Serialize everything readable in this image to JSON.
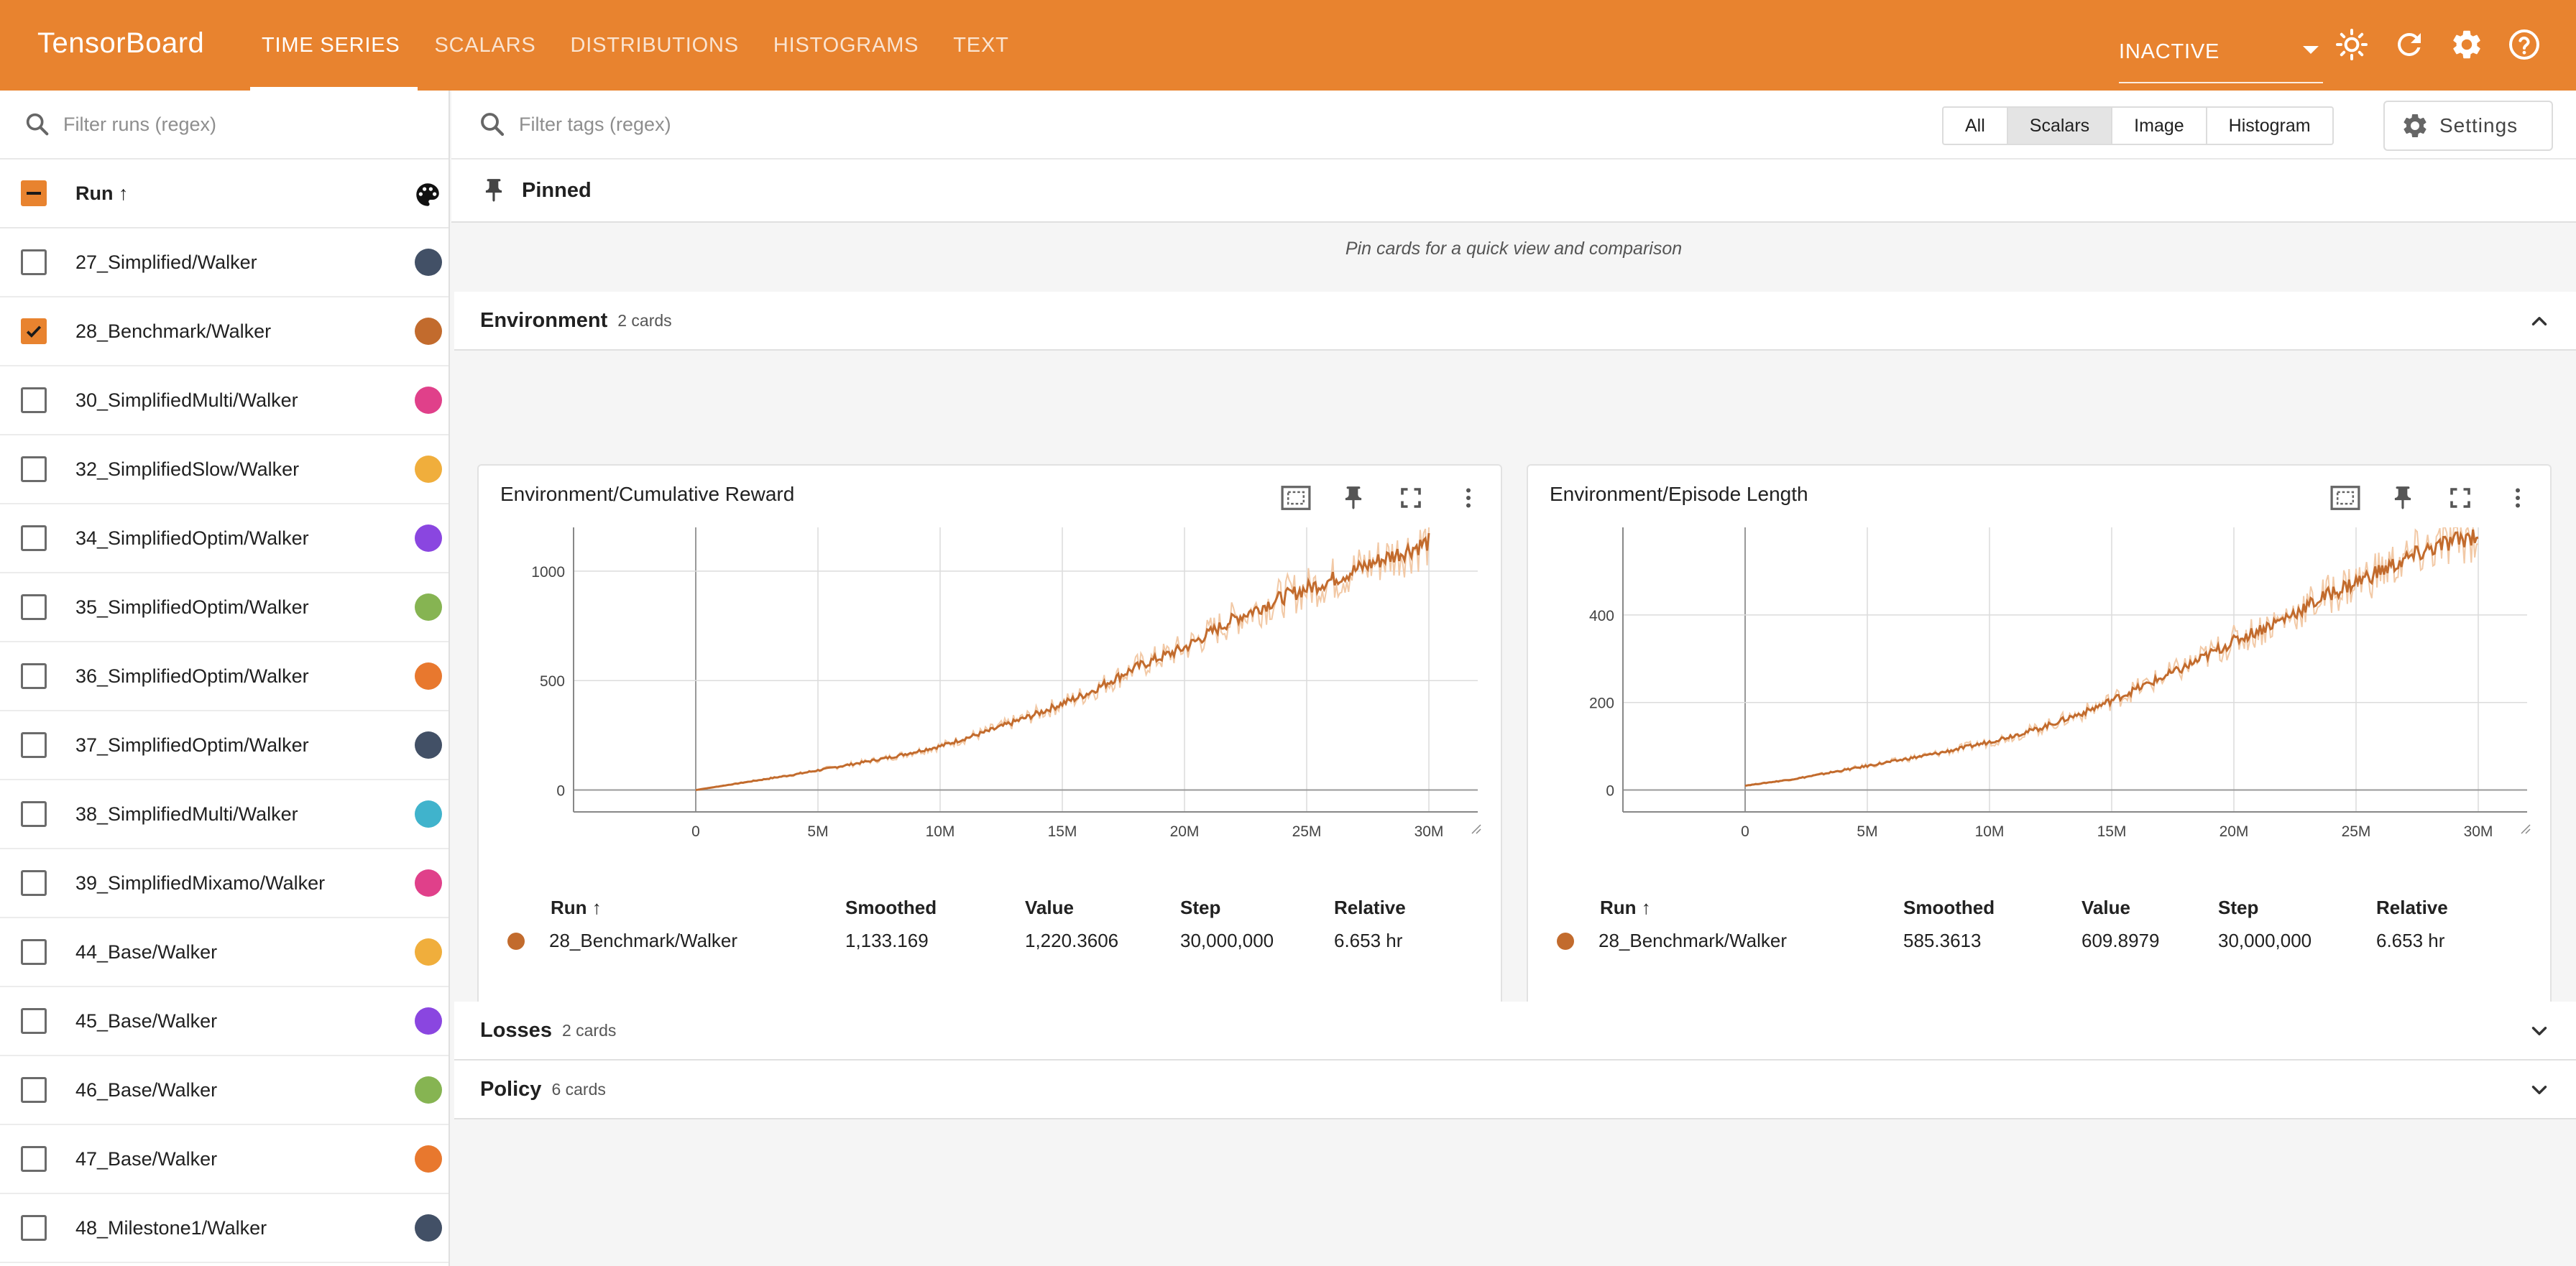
{
  "header": {
    "brand": "TensorBoard",
    "tabs": [
      {
        "label": "TIME SERIES",
        "active": true
      },
      {
        "label": "SCALARS"
      },
      {
        "label": "DISTRIBUTIONS"
      },
      {
        "label": "HISTOGRAMS"
      },
      {
        "label": "TEXT"
      }
    ],
    "reload_state": "INACTIVE",
    "icons": [
      "chevron-down-icon",
      "brightness-icon",
      "refresh-icon",
      "gear-icon",
      "help-icon"
    ]
  },
  "sidebar": {
    "filter_placeholder": "Filter runs (regex)",
    "header": {
      "label": "Run ↑"
    },
    "runs": [
      {
        "name": "27_Simplified/Walker",
        "checked": false,
        "color": "#425066"
      },
      {
        "name": "28_Benchmark/Walker",
        "checked": true,
        "color": "#c26b2d"
      },
      {
        "name": "30_SimplifiedMulti/Walker",
        "checked": false,
        "color": "#e0408a"
      },
      {
        "name": "32_SimplifiedSlow/Walker",
        "checked": false,
        "color": "#f0ae3c"
      },
      {
        "name": "34_SimplifiedOptim/Walker",
        "checked": false,
        "color": "#8a46e0"
      },
      {
        "name": "35_SimplifiedOptim/Walker",
        "checked": false,
        "color": "#86b452"
      },
      {
        "name": "36_SimplifiedOptim/Walker",
        "checked": false,
        "color": "#e8782e"
      },
      {
        "name": "37_SimplifiedOptim/Walker",
        "checked": false,
        "color": "#425066"
      },
      {
        "name": "38_SimplifiedMulti/Walker",
        "checked": false,
        "color": "#40b3cc"
      },
      {
        "name": "39_SimplifiedMixamo/Walker",
        "checked": false,
        "color": "#e0408a"
      },
      {
        "name": "44_Base/Walker",
        "checked": false,
        "color": "#f0ae3c"
      },
      {
        "name": "45_Base/Walker",
        "checked": false,
        "color": "#8a46e0"
      },
      {
        "name": "46_Base/Walker",
        "checked": false,
        "color": "#86b452"
      },
      {
        "name": "47_Base/Walker",
        "checked": false,
        "color": "#e8782e"
      },
      {
        "name": "48_Milestone1/Walker",
        "checked": false,
        "color": "#425066"
      }
    ]
  },
  "main": {
    "filter_placeholder": "Filter tags (regex)",
    "type_filters": [
      {
        "label": "All"
      },
      {
        "label": "Scalars",
        "active": true
      },
      {
        "label": "Image"
      },
      {
        "label": "Histogram"
      }
    ],
    "settings_label": "Settings",
    "pinned_label": "Pinned",
    "pin_hint": "Pin cards for a quick view and comparison",
    "groups": [
      {
        "name": "Environment",
        "count": "2 cards",
        "expanded": true
      },
      {
        "name": "Losses",
        "count": "2 cards",
        "expanded": false
      },
      {
        "name": "Policy",
        "count": "6 cards",
        "expanded": false
      }
    ],
    "table_headers": {
      "run": "Run ↑",
      "smoothed": "Smoothed",
      "value": "Value",
      "step": "Step",
      "relative": "Relative"
    },
    "cards": [
      {
        "title": "Environment/Cumulative Reward",
        "row": {
          "run": "28_Benchmark/Walker",
          "smoothed": "1,133.169",
          "value": "1,220.3606",
          "step": "30,000,000",
          "relative": "6.653 hr"
        }
      },
      {
        "title": "Environment/Episode Length",
        "row": {
          "run": "28_Benchmark/Walker",
          "smoothed": "585.3613",
          "value": "609.8979",
          "step": "30,000,000",
          "relative": "6.653 hr"
        }
      }
    ]
  },
  "colors": {
    "accent": "#e8832f",
    "series": "#c26b2d",
    "series_raw": "#f2c9a6"
  },
  "chart_data": [
    {
      "type": "line",
      "title": "Environment/Cumulative Reward",
      "x_tick_labels": [
        "0",
        "5M",
        "10M",
        "15M",
        "20M",
        "25M",
        "30M"
      ],
      "y_tick_labels": [
        "0",
        "500",
        "1000"
      ],
      "xlim": [
        -5000000,
        32000000
      ],
      "ylim": [
        -100,
        1200
      ],
      "grid": true,
      "series": [
        {
          "name": "28_Benchmark/Walker",
          "x": [
            0,
            2000000,
            4000000,
            6000000,
            8000000,
            10000000,
            12000000,
            14000000,
            16000000,
            18000000,
            20000000,
            22000000,
            24000000,
            26000000,
            28000000,
            30000000
          ],
          "y": [
            0,
            35,
            70,
            110,
            150,
            200,
            270,
            350,
            440,
            560,
            650,
            780,
            880,
            960,
            1050,
            1133
          ]
        }
      ]
    },
    {
      "type": "line",
      "title": "Environment/Episode Length",
      "x_tick_labels": [
        "0",
        "5M",
        "10M",
        "15M",
        "20M",
        "25M",
        "30M"
      ],
      "y_tick_labels": [
        "0",
        "200",
        "400"
      ],
      "xlim": [
        -5000000,
        32000000
      ],
      "ylim": [
        -50,
        600
      ],
      "grid": true,
      "series": [
        {
          "name": "28_Benchmark/Walker",
          "x": [
            0,
            2000000,
            4000000,
            6000000,
            8000000,
            10000000,
            12000000,
            14000000,
            16000000,
            18000000,
            20000000,
            22000000,
            24000000,
            26000000,
            28000000,
            30000000
          ],
          "y": [
            10,
            25,
            45,
            65,
            85,
            110,
            140,
            180,
            230,
            280,
            340,
            390,
            450,
            500,
            550,
            585
          ]
        }
      ]
    }
  ]
}
